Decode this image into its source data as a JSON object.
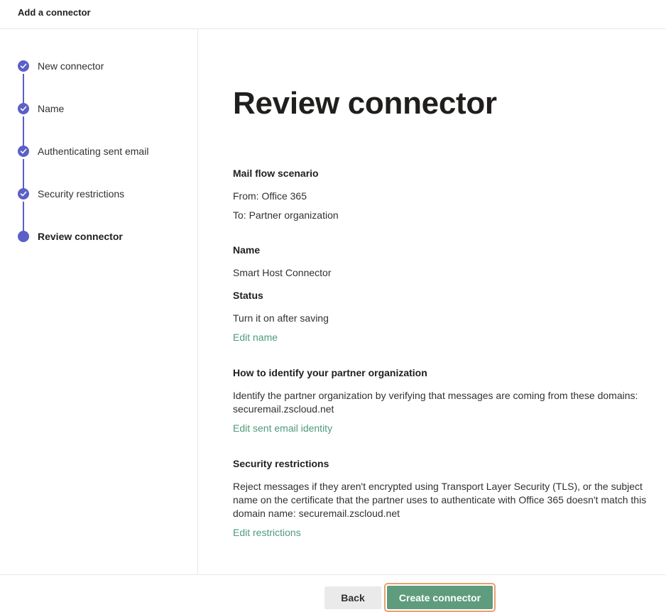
{
  "header": {
    "title": "Add a connector"
  },
  "steps": [
    {
      "label": "New connector",
      "state": "completed"
    },
    {
      "label": "Name",
      "state": "completed"
    },
    {
      "label": "Authenticating sent email",
      "state": "completed"
    },
    {
      "label": "Security restrictions",
      "state": "completed"
    },
    {
      "label": "Review connector",
      "state": "current"
    }
  ],
  "main": {
    "title": "Review connector",
    "mail_flow": {
      "heading": "Mail flow scenario",
      "from": "From: Office 365",
      "to": "To: Partner organization"
    },
    "name_section": {
      "heading": "Name",
      "value": "Smart Host Connector",
      "status_heading": "Status",
      "status_value": "Turn it on after saving",
      "edit_link": "Edit name"
    },
    "identify_section": {
      "heading": "How to identify your partner organization",
      "text": "Identify the partner organization by verifying that messages are coming from these domains: securemail.zscloud.net",
      "edit_link": "Edit sent email identity"
    },
    "security_section": {
      "heading": "Security restrictions",
      "text": "Reject messages if they aren't encrypted using Transport Layer Security (TLS), or the subject name on the certificate that the partner uses to authenticate with Office 365 doesn't match this domain name: securemail.zscloud.net",
      "edit_link": "Edit restrictions"
    }
  },
  "footer": {
    "back_label": "Back",
    "create_label": "Create connector"
  },
  "colors": {
    "accent": "#5b5fc7",
    "primary_button": "#5e9c7d",
    "link": "#4e9a7a",
    "focus_ring": "#e8a06f"
  },
  "icons": {
    "completed_step": "checkmark-icon",
    "current_step": "current-step-dot-icon"
  }
}
